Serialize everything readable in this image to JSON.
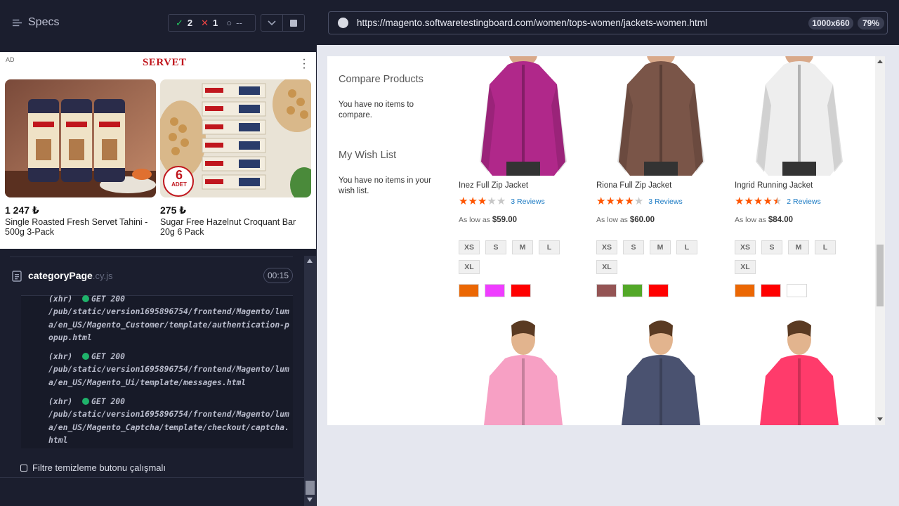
{
  "runner": {
    "specs_label": "Specs",
    "passed": "2",
    "failed": "1",
    "pending": "--",
    "spec_name": "categoryPage",
    "spec_ext": ".cy.js",
    "timer": "00:15",
    "logs": [
      {
        "prefix": "(xhr)",
        "method": "GET 200",
        "path": "/pub/static/version1695896754/frontend/Magento/luma/en_US/Magento_Customer/template/authentication-popup.html"
      },
      {
        "prefix": "(xhr)",
        "method": "GET 200",
        "path": "/pub/static/version1695896754/frontend/Magento/luma/en_US/Magento_Ui/template/messages.html"
      },
      {
        "prefix": "(xhr)",
        "method": "GET 200",
        "path": "/pub/static/version1695896754/frontend/Magento/luma/en_US/Magento_Captcha/template/checkout/captcha.html"
      }
    ],
    "test_title": "Filtre temizleme butonu çalışmalı"
  },
  "ad": {
    "label": "AD",
    "brand": "SERVET",
    "items": [
      {
        "price": "1 247 ₺",
        "name": "Single Roasted Fresh Servet Tahini - 500g 3-Pack"
      },
      {
        "price": "275 ₺",
        "name": "Sugar Free Hazelnut Croquant Bar 20g 6 Pack",
        "badge_num": "6",
        "badge_text": "ADET"
      }
    ]
  },
  "browser": {
    "url": "https://magento.softwaretestingboard.com/women/tops-women/jackets-women.html",
    "viewport": "1000x660",
    "zoom": "79%"
  },
  "page": {
    "compare_title": "Compare Products",
    "compare_text": "You have no items to compare.",
    "wishlist_title": "My Wish List",
    "wishlist_text": "You have no items in your wish list.",
    "products": [
      {
        "name": "Inez Full Zip Jacket",
        "rating": 3,
        "reviews": "3 Reviews",
        "price_label": "As low as",
        "price": "$59.00",
        "sizes": [
          "XS",
          "S",
          "M",
          "L",
          "XL"
        ],
        "colors": [
          "#eb6703",
          "#ef3dff",
          "#ff0000"
        ],
        "jacket": "#b0288a"
      },
      {
        "name": "Riona Full Zip Jacket",
        "rating": 4,
        "reviews": "3 Reviews",
        "price_label": "As low as",
        "price": "$60.00",
        "sizes": [
          "XS",
          "S",
          "M",
          "L",
          "XL"
        ],
        "colors": [
          "#945454",
          "#53a828",
          "#ff0000"
        ],
        "jacket": "#7a5548"
      },
      {
        "name": "Ingrid Running Jacket",
        "rating": 4.5,
        "reviews": "2 Reviews",
        "price_label": "As low as",
        "price": "$84.00",
        "sizes": [
          "XS",
          "S",
          "M",
          "L",
          "XL"
        ],
        "colors": [
          "#eb6703",
          "#ff0000",
          "#ffffff"
        ],
        "jacket": "#eeeeee"
      }
    ],
    "row2_jackets": [
      "#f7a0c4",
      "#4a5270",
      "#ff3b6b"
    ]
  }
}
